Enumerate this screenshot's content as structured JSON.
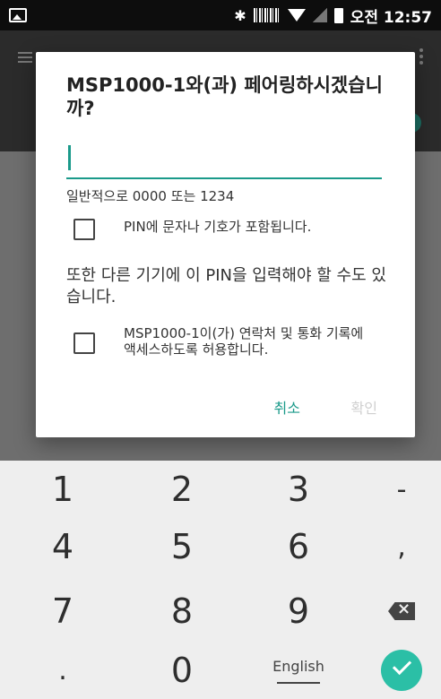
{
  "status_bar": {
    "time": "오전 12:57"
  },
  "dialog": {
    "title": "MSP1000-1와(과) 페어링하시겠습니까?",
    "pin_value": "",
    "hint": "일반적으로 0000 또는 1234",
    "checkbox_pin_label": "PIN에 문자나 기호가 포함됩니다.",
    "info_text": "또한 다른 기기에 이 PIN을 입력해야 할 수도 있습니다.",
    "checkbox_contacts_label": "MSP1000-1이(가) 연락처 및 통화 기록에 액세스하도록 허용합니다.",
    "cancel_label": "취소",
    "ok_label": "확인"
  },
  "keypad": {
    "keys": [
      "1",
      "2",
      "3",
      "-",
      "4",
      "5",
      "6",
      ",",
      "7",
      "8",
      "9",
      ".",
      "0"
    ],
    "lang_label": "English"
  },
  "colors": {
    "accent": "#1a9a8a",
    "enter": "#2bbfa6",
    "disabled": "#cfcfcf"
  }
}
